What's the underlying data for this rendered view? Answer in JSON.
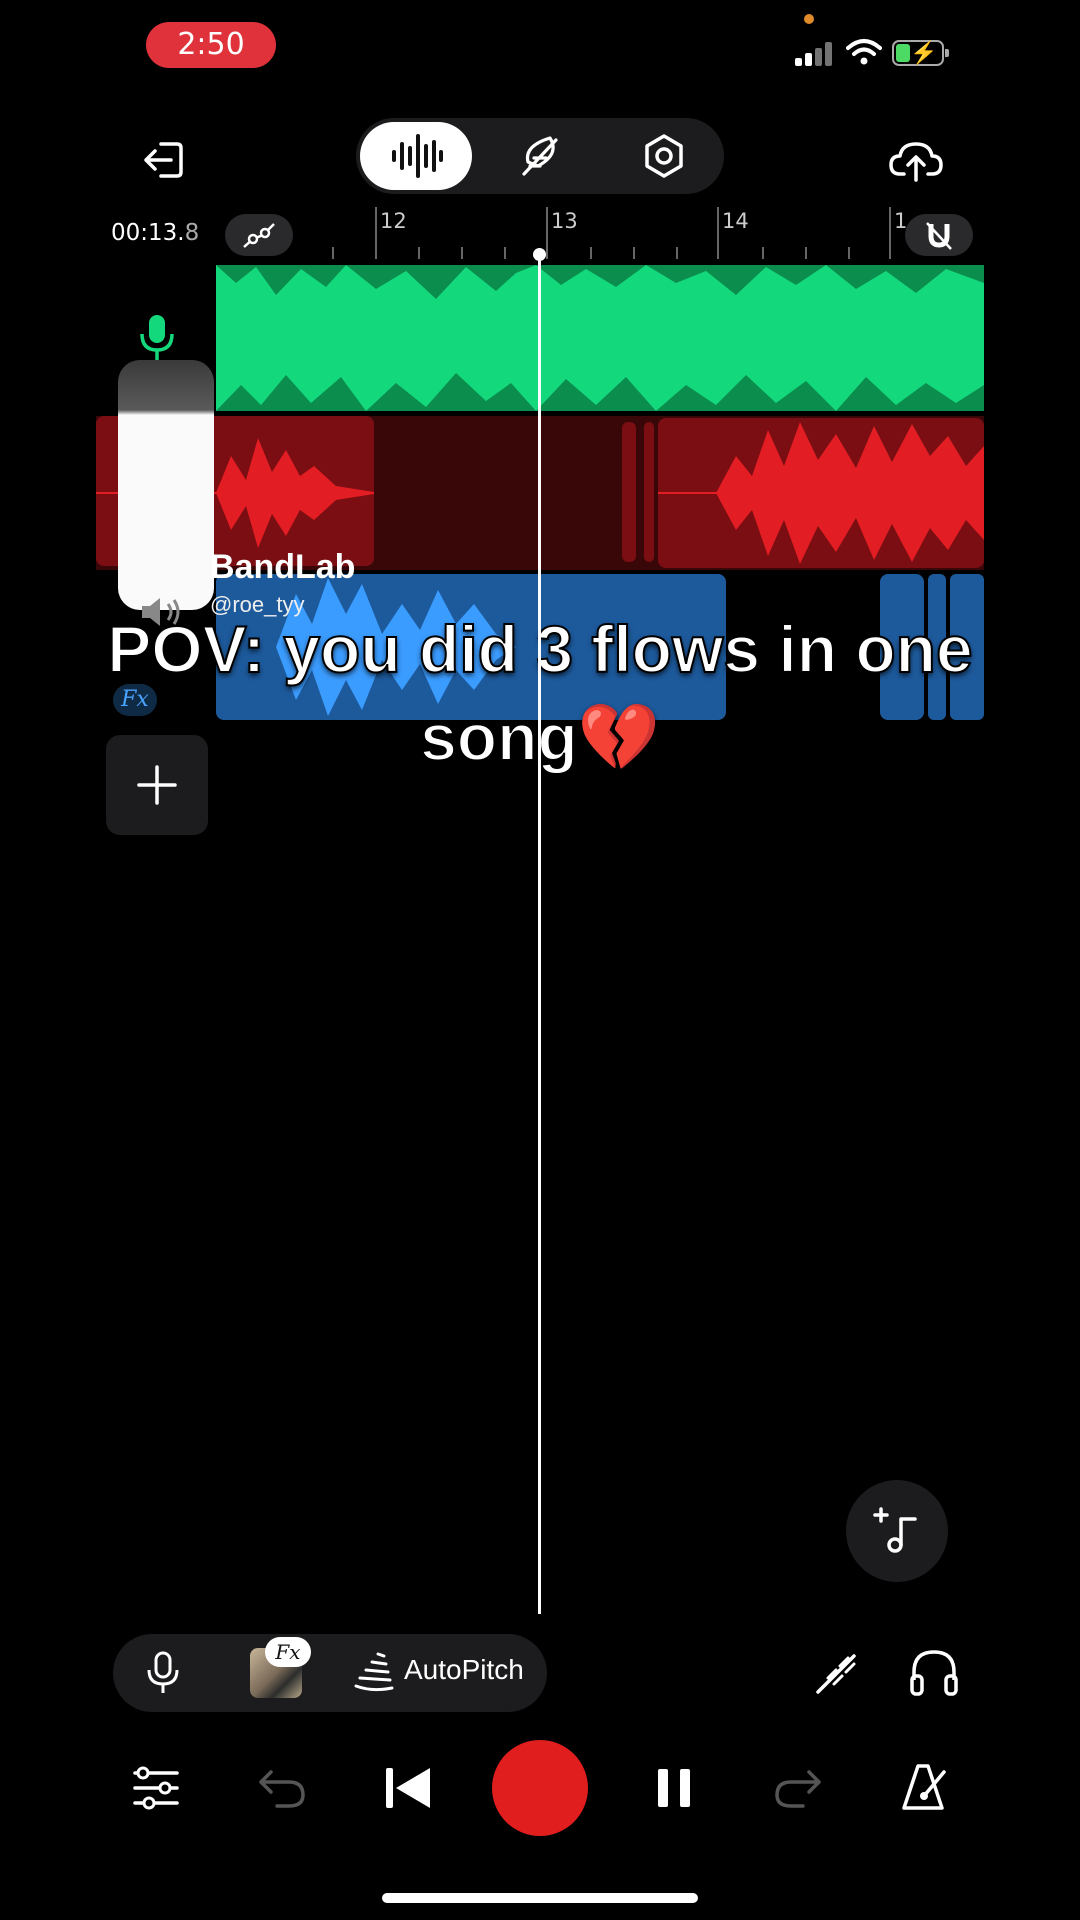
{
  "status_bar": {
    "time": "2:50",
    "battery_level": 0.3,
    "colors": {
      "time_pill": "#e0323b",
      "battery_fill": "#4cd964"
    }
  },
  "toolbar": {
    "exit_icon": "exit-icon",
    "modes": [
      {
        "name": "waveform-mode-icon",
        "active": true
      },
      {
        "name": "feather-mode-icon",
        "active": false
      },
      {
        "name": "settings-mode-icon",
        "active": false
      }
    ],
    "upload_icon": "cloud-upload-icon"
  },
  "timeline": {
    "timecode_main": "00:13.",
    "timecode_frac": "8",
    "ruler_labels": [
      "12",
      "13",
      "14",
      "1"
    ],
    "playhead_seconds": 13.0
  },
  "tracks": [
    {
      "name": "vocal-track",
      "color": "#14d97c"
    },
    {
      "name": "red-track",
      "color": "#e21d23"
    },
    {
      "name": "blue-track",
      "color": "#3b9cff"
    }
  ],
  "watermark": {
    "brand": "BandLab",
    "handle": "@roe_tyy"
  },
  "track_fx_label": "Fx",
  "caption": "POV: you did 3 flows in one song💔",
  "bottom_tools": {
    "fx_tag": "Fx",
    "autopitch_label": "AutoPitch"
  },
  "transport": {
    "record_color": "#e01e1e"
  }
}
